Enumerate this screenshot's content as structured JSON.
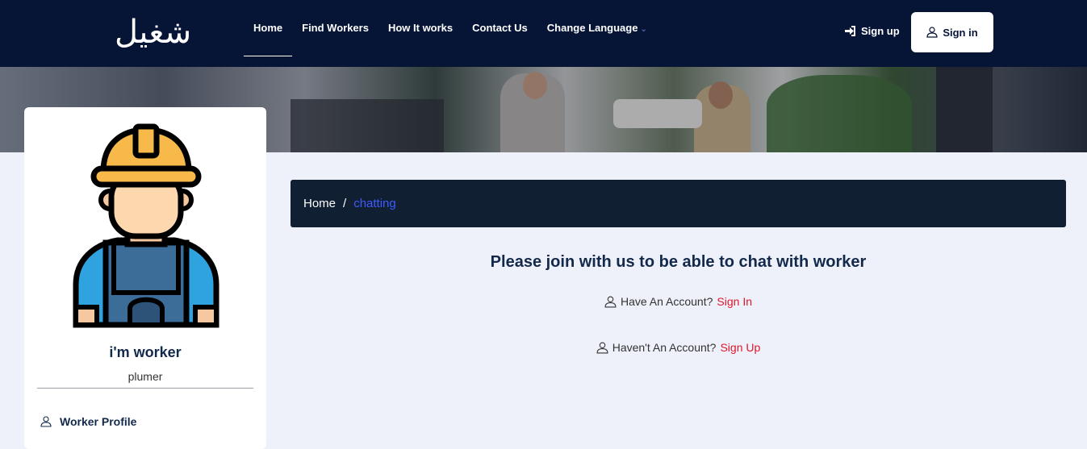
{
  "header": {
    "logo_text": "شغيل",
    "nav": [
      {
        "label": "Home",
        "active": true
      },
      {
        "label": "Find Workers"
      },
      {
        "label": "How It works"
      },
      {
        "label": "Contact Us"
      },
      {
        "label": "Change Language"
      }
    ],
    "signup_label": "Sign up",
    "signin_label": "Sign in"
  },
  "profile": {
    "name": "i'm worker",
    "job": "plumer",
    "link_label": "Worker Profile"
  },
  "breadcrumb": {
    "home": "Home",
    "separator": "/",
    "current": "chatting"
  },
  "main": {
    "title": "Please join with us to be able to chat with worker",
    "have_account_text": "Have An Account?",
    "have_account_link": "Sign In",
    "no_account_text": "Haven't An Account?",
    "no_account_link": "Sign Up"
  },
  "colors": {
    "navbar": "#061436",
    "accent_red": "#e0162b",
    "breadcrumb_bg": "#111f32",
    "breadcrumb_current": "#3d5bff"
  },
  "icons": [
    "sign-in-arrow-icon",
    "user-outline-icon",
    "chevron-down-icon",
    "worker-avatar-illustration"
  ]
}
